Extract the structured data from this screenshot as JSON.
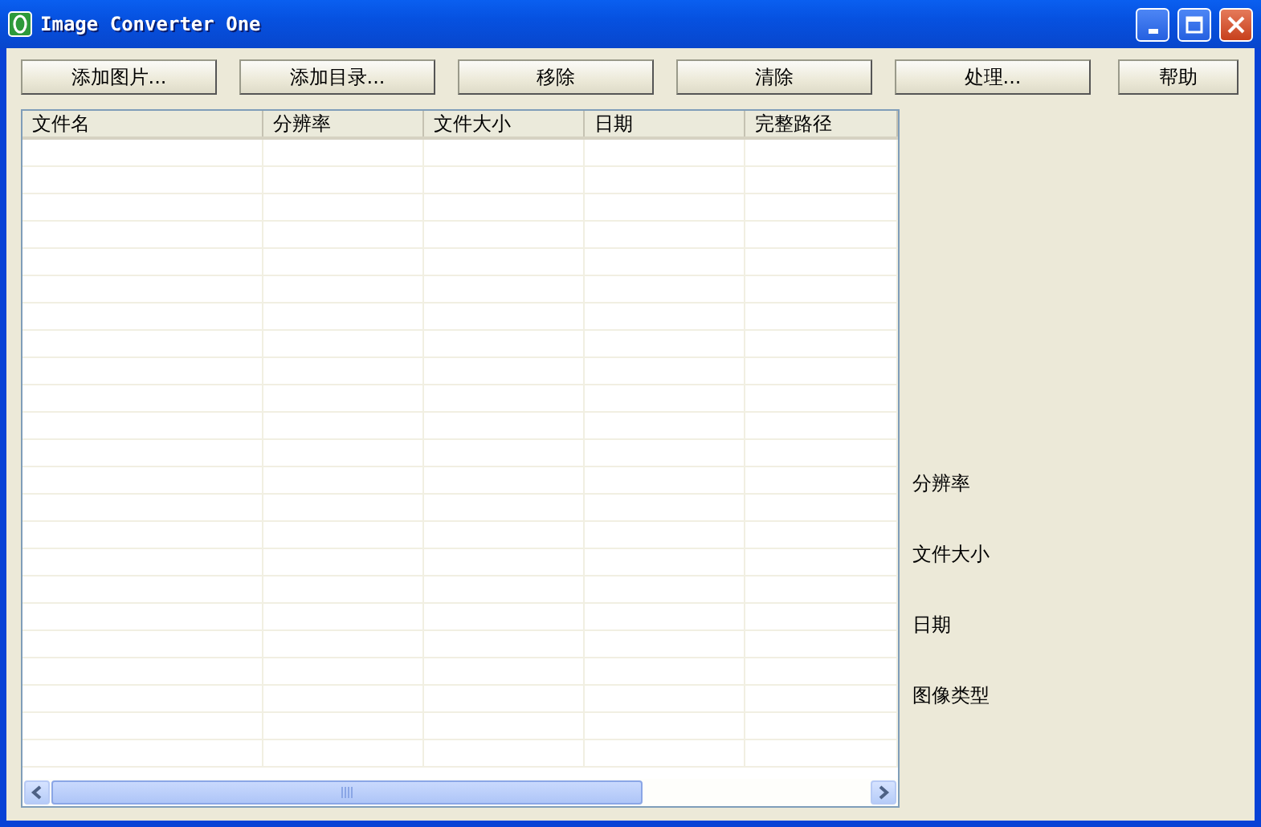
{
  "window": {
    "title": "Image Converter One"
  },
  "toolbar": [
    "添加图片...",
    "添加目录...",
    "移除",
    "清除",
    "处理...",
    "帮助"
  ],
  "table": {
    "columns": [
      "文件名",
      "分辨率",
      "文件大小",
      "日期",
      "完整路径"
    ]
  },
  "details": [
    "分辨率",
    "文件大小",
    "日期",
    "图像类型"
  ]
}
